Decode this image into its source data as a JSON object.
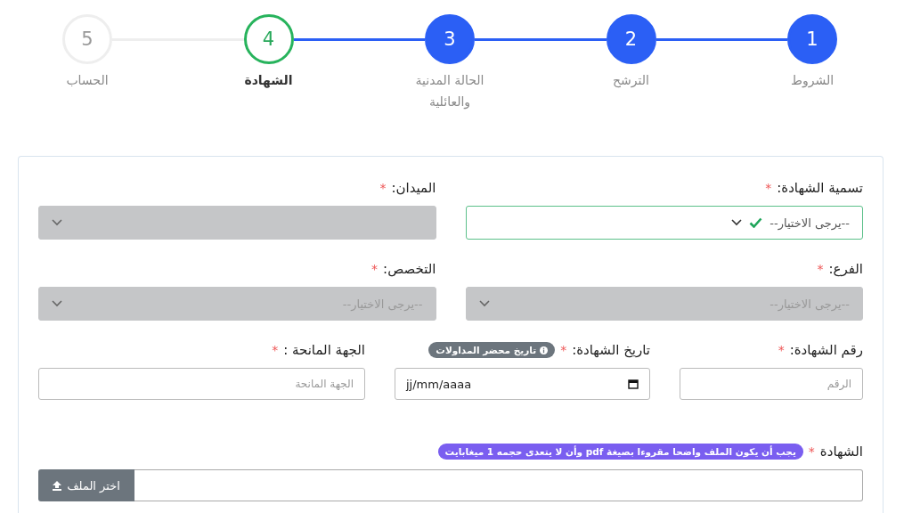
{
  "steps": [
    {
      "number": "1",
      "label": "الشروط",
      "completed": true,
      "selected": false
    },
    {
      "number": "2",
      "label": "الترشح",
      "completed": true,
      "selected": false
    },
    {
      "number": "3",
      "label": "الحالة المدنية والعائلية",
      "completed": true,
      "selected": false
    },
    {
      "number": "4",
      "label": "الشهادة",
      "completed": false,
      "selected": true
    },
    {
      "number": "5",
      "label": "الحساب",
      "completed": false,
      "selected": false
    }
  ],
  "form": {
    "rows": [
      [
        {
          "kind": "select",
          "label": "تسمية الشهادة:",
          "asterisk": "*",
          "value": "--يرجى الاختيار--",
          "valid": true,
          "disabled": false
        },
        {
          "kind": "select",
          "label": "الميدان:",
          "asterisk": "*",
          "disabled": true,
          "valid": false
        }
      ],
      [
        {
          "kind": "select",
          "label": "الفرع:",
          "asterisk": "*",
          "placeholder": "--يرجى الاختيار--",
          "disabled": true,
          "valid": false
        },
        {
          "kind": "select",
          "label": "التخصص:",
          "asterisk": "*",
          "placeholder": "--يرجى الاختيار--",
          "disabled": true,
          "valid": false
        }
      ],
      [
        {
          "kind": "text",
          "label": "رقم الشهادة:",
          "asterisk": "*",
          "placeholder": "الرقم"
        },
        {
          "kind": "date",
          "label": "تاريخ الشهادة:",
          "asterisk": "*",
          "badge": "تاريخ محضر المداولات",
          "value": "jj/mm/aaaa"
        },
        {
          "kind": "text",
          "label": "الجهة المانحة :",
          "asterisk": "*",
          "placeholder": "الجهة المانحة"
        }
      ],
      [
        {
          "kind": "file",
          "label": "الشهادة",
          "asterisk": "*",
          "hint": "يجب أن يكون الملف واضحا مقروءا بصيغة pdf وأن لا يتعدى حجمه 1 ميغابايت",
          "button": "اختر الملف"
        }
      ]
    ]
  }
}
